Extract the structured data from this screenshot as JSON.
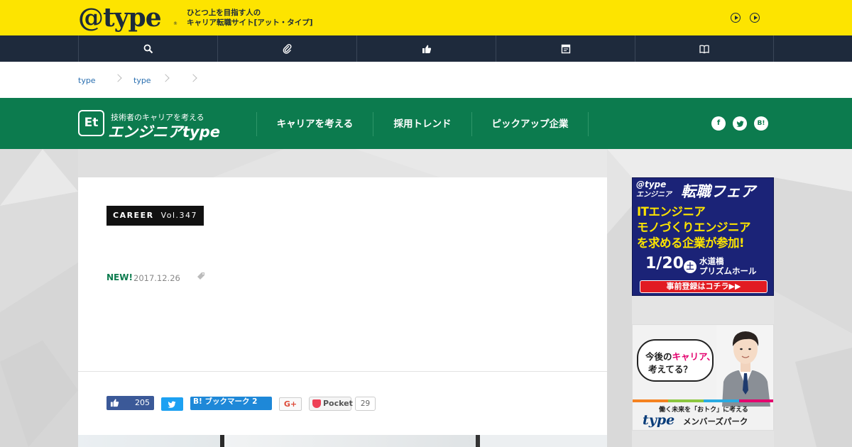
{
  "topbar": {
    "logo": "@type",
    "tagline_line1": "ひとつ上を目指す人の",
    "tagline_line2": "キャリア転職サイト[アット・タイプ]"
  },
  "darknav": {
    "icons": [
      "search-icon",
      "paperclip-icon",
      "thumbs-up-icon",
      "calendar-icon",
      "book-icon"
    ]
  },
  "breadcrumb": {
    "items": [
      "type",
      "type"
    ]
  },
  "site_header": {
    "logo_badge": "Et",
    "logo_sub": "技術者のキャリアを考える",
    "logo_name": "エンジニアtype",
    "nav": [
      "キャリアを考える",
      "採用トレンド",
      "ピックアップ企業"
    ],
    "social": [
      "f",
      "t",
      "B!"
    ]
  },
  "article": {
    "badge_category": "CAREER",
    "badge_vol": "Vol.347",
    "new_label": "NEW!",
    "date": "2017.12.26"
  },
  "share": {
    "facebook_count": "205",
    "hatena_label": "B! ブックマーク 2",
    "gplus_label": "G+",
    "pocket_label": "Pocket",
    "pocket_count": "29"
  },
  "ad_fair": {
    "brand": "@type",
    "brand_sub": "エンジニア",
    "title": "転職フェア",
    "line1": "ITエンジニア",
    "line2": "モノづくりエンジニア",
    "line3": "を求める企業が参加!",
    "date": "1/20",
    "day": "土",
    "venue_line1": "水道橋",
    "venue_line2": "プリズムホール",
    "cta": "事前登録はコチラ▶▶"
  },
  "ad_members": {
    "q_prefix": "今後の",
    "q_highlight": "キャリア",
    "q_suffix": "、",
    "q_line2": "考えてる？",
    "sub": "働く未来を「おトク」に考える",
    "brand": "type",
    "brand_suffix": "メンバーズパーク"
  }
}
